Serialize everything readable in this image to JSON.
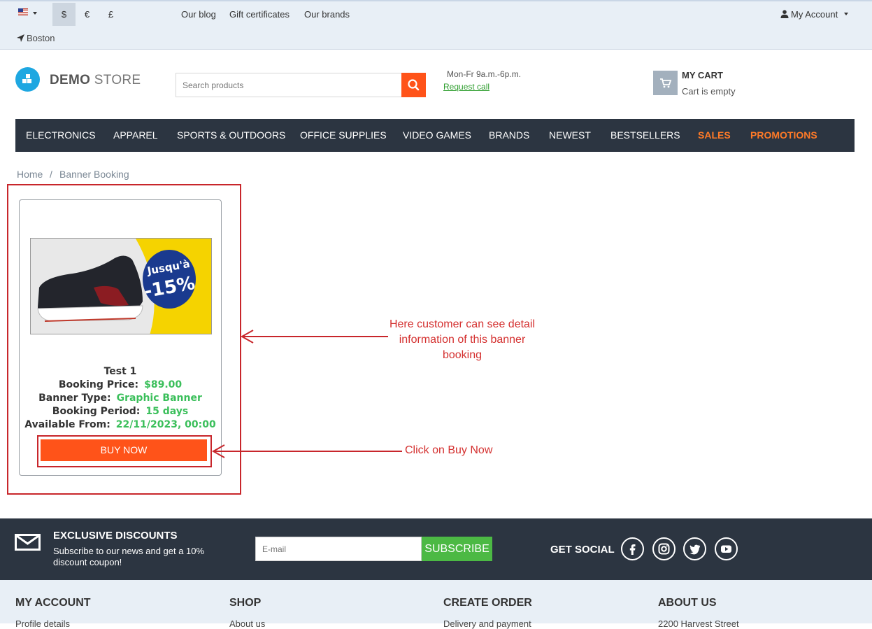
{
  "topbar": {
    "currencies": [
      "$",
      "€",
      "£"
    ],
    "links": [
      "Our blog",
      "Gift certificates",
      "Our brands"
    ],
    "account": "My Account",
    "city": "Boston"
  },
  "header": {
    "logo_bold": "DEMO",
    "logo_light": "STORE",
    "search_placeholder": "Search products",
    "hours": "Mon-Fr 9a.m.-6p.m.",
    "request_call": "Request call",
    "cart_title": "MY CART",
    "cart_status": "Cart is empty"
  },
  "nav": {
    "items": [
      "ELECTRONICS",
      "APPAREL",
      "SPORTS & OUTDOORS",
      "OFFICE SUPPLIES",
      "VIDEO GAMES",
      "BRANDS",
      "NEWEST",
      "BESTSELLERS",
      "SALES",
      "PROMOTIONS"
    ]
  },
  "breadcrumb": {
    "home": "Home",
    "separator": "/",
    "current": "Banner Booking"
  },
  "product": {
    "banner_text_1": "Jusqu'à",
    "banner_text_2": "-15%",
    "name": "Test 1",
    "price_label": "Booking Price:",
    "price": "$89.00",
    "type_label": "Banner Type:",
    "type": "Graphic Banner",
    "period_label": "Booking Period:",
    "period": "15 days",
    "available_label": "Available From:",
    "available": "22/11/2023, 00:00",
    "buy_label": "BUY NOW"
  },
  "annotations": {
    "detail_note": "Here customer can see detail information of this banner booking",
    "buy_note": "Click on Buy Now",
    "color": "#d4302f"
  },
  "footer": {
    "discount_title": "EXCLUSIVE DISCOUNTS",
    "discount_sub": "Subscribe to our news and get a 10% discount coupon!",
    "email_placeholder": "E-mail",
    "subscribe_label": "SUBSCRIBE",
    "social_title": "GET SOCIAL",
    "columns": [
      "MY ACCOUNT",
      "SHOP",
      "CREATE ORDER",
      "ABOUT US"
    ],
    "first_links": [
      "Profile details",
      "About us",
      "Delivery and payment",
      "2200 Harvest Street"
    ]
  },
  "colors": {
    "accent": "#ff5319",
    "nav_bg": "#2c3541",
    "value_green": "#3bbf5b",
    "hot_link": "#ff7a27"
  }
}
